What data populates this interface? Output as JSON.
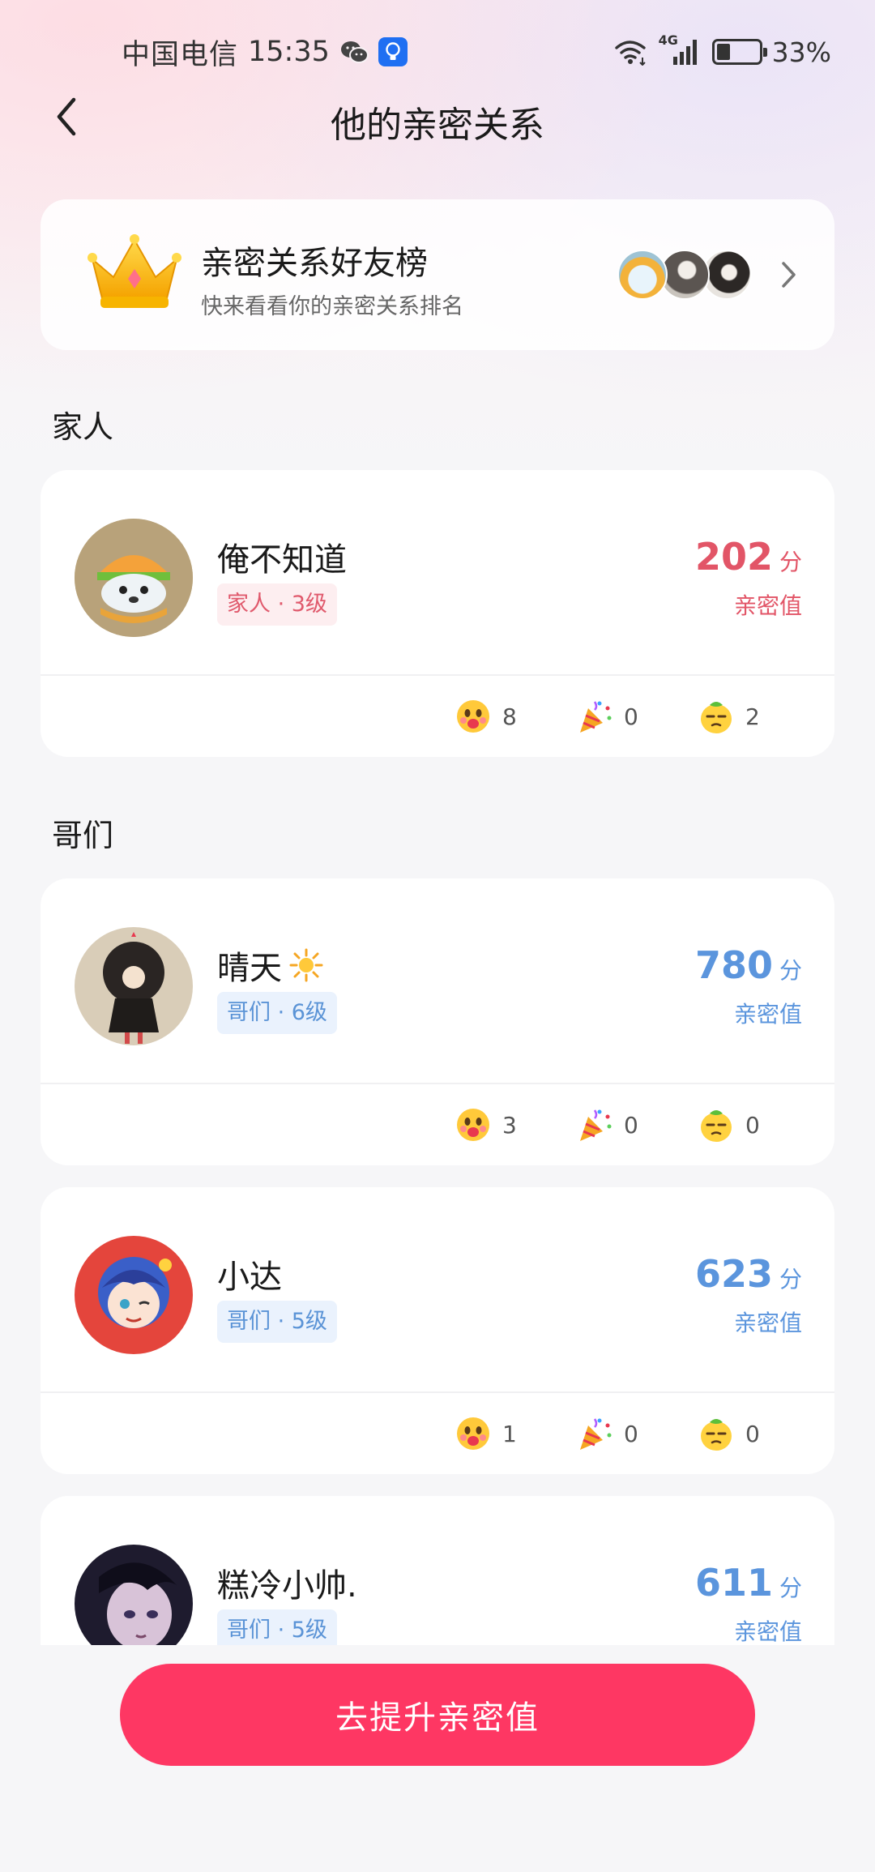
{
  "status_bar": {
    "carrier": "中国电信",
    "time": "15:35",
    "network": "4G",
    "battery_level": 0.33,
    "battery_text": "33%"
  },
  "header": {
    "title": "他的亲密关系"
  },
  "ranking": {
    "title": "亲密关系好友榜",
    "subtitle": "快来看看你的亲密关系排名"
  },
  "sections": [
    {
      "title": "家人",
      "members": [
        {
          "name": "俺不知道",
          "tag": "家人 · 3级",
          "score": "202",
          "unit": "分",
          "score_label": "亲密值",
          "counters": [
            "8",
            "0",
            "2"
          ]
        }
      ]
    },
    {
      "title": "哥们",
      "members": [
        {
          "name": "晴天",
          "tag": "哥们 · 6级",
          "score": "780",
          "unit": "分",
          "score_label": "亲密值",
          "counters": [
            "3",
            "0",
            "0"
          ]
        },
        {
          "name": "小达",
          "tag": "哥们 · 5级",
          "score": "623",
          "unit": "分",
          "score_label": "亲密值",
          "counters": [
            "1",
            "0",
            "0"
          ]
        },
        {
          "name": "糕冷小帅.",
          "tag": "哥们 · 5级",
          "score": "611",
          "unit": "分",
          "score_label": "亲密值"
        }
      ]
    }
  ],
  "cta": {
    "label": "去提升亲密值"
  },
  "colors": {
    "accent": "#fe3763",
    "family_score": "#e25567",
    "buddy_score": "#5b95dd"
  },
  "icons": {
    "counter_1": "blushing-face-icon",
    "counter_2": "party-popper-icon",
    "counter_3": "lemon-face-icon"
  }
}
